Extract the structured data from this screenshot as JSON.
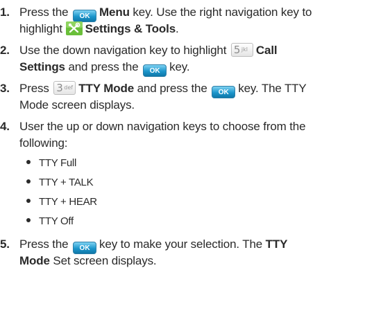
{
  "steps": [
    {
      "num": "1.",
      "l1_a": "Press the",
      "l1_bold": "Menu",
      "l1_b": "key. Use the right navigation key to",
      "l2_a": "highlight",
      "l2_bold": "Settings & Tools",
      "l2_b": "."
    },
    {
      "num": "2.",
      "l1_a": "Use the down navigation key to highlight",
      "l1_bold": "Call",
      "l2_bold": "Settings",
      "l2_a": "and press the",
      "l2_b": "key."
    },
    {
      "num": "3.",
      "l1_a": "Press",
      "l1_bold": "TTY Mode",
      "l1_b": "and press the",
      "l1_c": "key. The TTY",
      "l2_a": "Mode screen displays."
    },
    {
      "num": "4.",
      "l1_a": "User the up or down navigation keys to choose from the",
      "l2_a": "following:",
      "options": [
        "TTY Full",
        "TTY + TALK",
        "TTY + HEAR",
        "TTY Off"
      ]
    },
    {
      "num": "5.",
      "l1_a": "Press the",
      "l1_b": "key to make your selection. The",
      "l1_bold": "TTY",
      "l2_bold": "Mode",
      "l2_a": "Set screen displays."
    }
  ],
  "icons": {
    "ok_key_label": "OK",
    "num5_digit": "5",
    "num5_sub": "jkl",
    "num3_digit": "3",
    "num3_sub": "def",
    "ok_key_color": "#1c96cc",
    "tools_icon": "settings-tools-icon"
  }
}
